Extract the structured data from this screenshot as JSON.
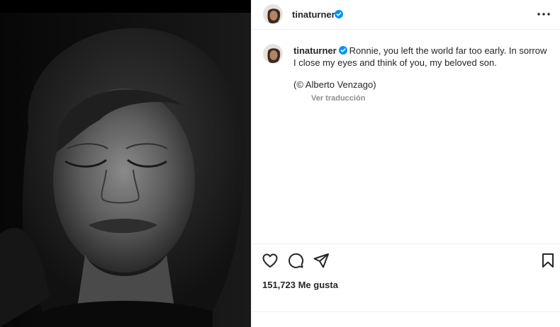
{
  "post": {
    "username": "tinaturner",
    "verified": true,
    "caption": "Ronnie, you left the world far too early. In sorrow I close my eyes and think of you, my beloved son.",
    "credit": "(© Alberto Venzago)",
    "translate_label": "Ver traducción",
    "likes_label": "151,723 Me gusta"
  },
  "icons": {
    "more": "more-horizontal-icon",
    "like": "heart-icon",
    "comment": "comment-icon",
    "share": "paper-plane-icon",
    "save": "bookmark-icon",
    "verified": "verified-badge-icon"
  },
  "colors": {
    "verified_blue": "#0095f6",
    "muted_text": "#8e8e8e",
    "text": "#262626",
    "photo_bg": "#0b0b0b"
  }
}
